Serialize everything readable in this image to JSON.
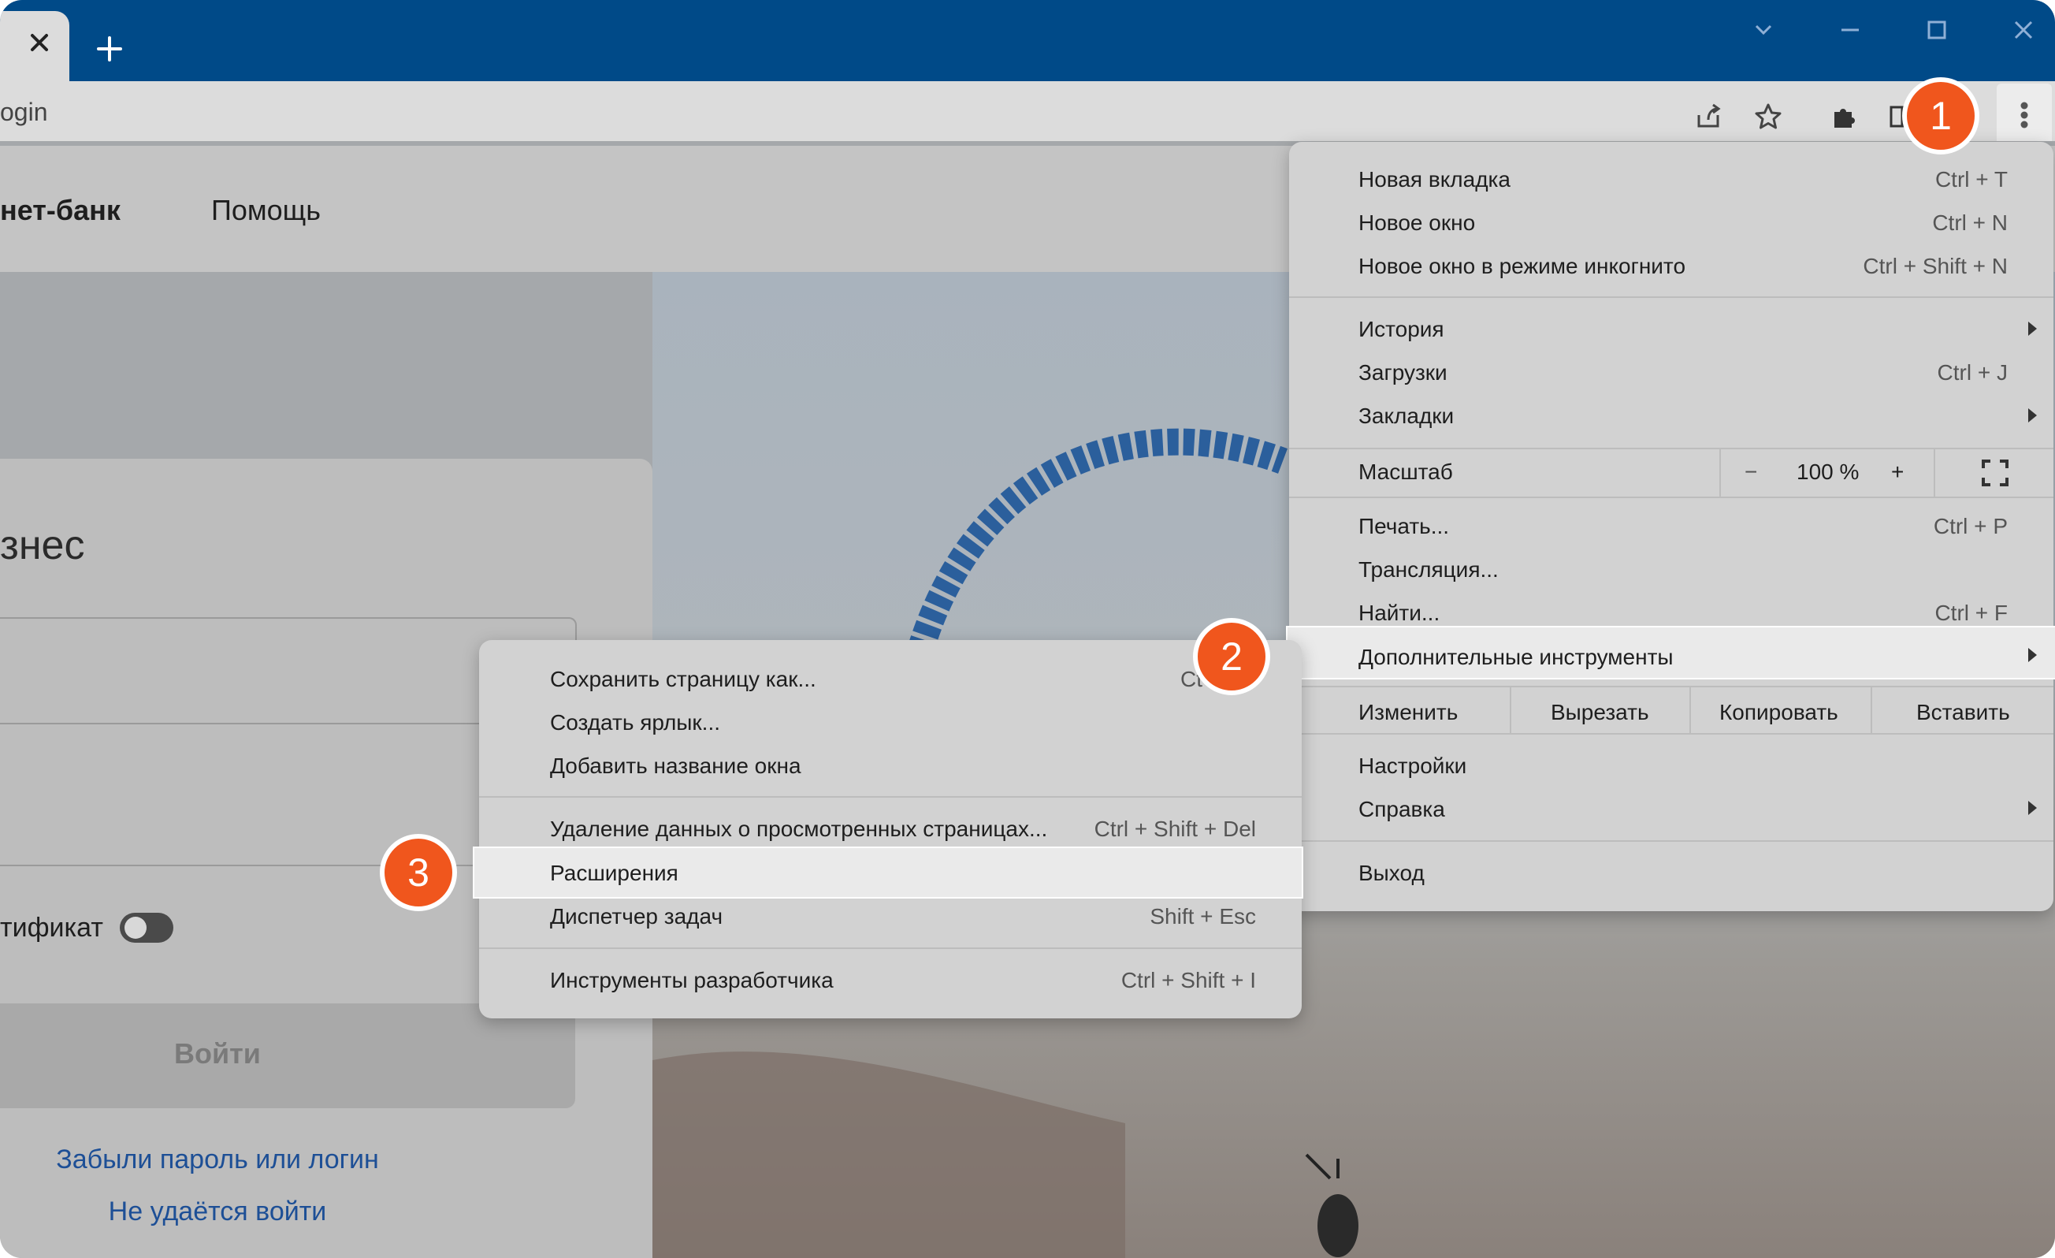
{
  "browser": {
    "new_tab_symbol": "+",
    "address": "ogin",
    "window_controls": [
      "chevron-down-icon",
      "minimize-icon",
      "maximize-icon",
      "close-icon"
    ],
    "toolbar_icons": [
      "share-icon",
      "star-icon",
      "puzzle-icon",
      "sidepanel-icon"
    ]
  },
  "page": {
    "nav": {
      "bank": "нет-банк",
      "help": "Помощь"
    },
    "card_title": "знес",
    "cert_label": "тификат",
    "login_button": "Войти",
    "forgot_link": "Забыли пароль или логин",
    "cant_login_link": "Не удаётся войти"
  },
  "main_menu": {
    "new_tab": {
      "label": "Новая вкладка",
      "shortcut": "Ctrl + T"
    },
    "new_window": {
      "label": "Новое окно",
      "shortcut": "Ctrl + N"
    },
    "incognito": {
      "label": "Новое окно в режиме инкогнито",
      "shortcut": "Ctrl + Shift + N"
    },
    "history": {
      "label": "История"
    },
    "downloads": {
      "label": "Загрузки",
      "shortcut": "Ctrl + J"
    },
    "bookmarks": {
      "label": "Закладки"
    },
    "zoom": {
      "label": "Масштаб",
      "minus": "−",
      "value": "100 %",
      "plus": "+"
    },
    "print": {
      "label": "Печать...",
      "shortcut": "Ctrl + P"
    },
    "cast": {
      "label": "Трансляция..."
    },
    "find": {
      "label": "Найти...",
      "shortcut": "Ctrl + F"
    },
    "more_tools": {
      "label": "Дополнительные инструменты"
    },
    "edit": {
      "label": "Изменить",
      "cut": "Вырезать",
      "copy": "Копировать",
      "paste": "Вставить"
    },
    "settings": {
      "label": "Настройки"
    },
    "help": {
      "label": "Справка"
    },
    "exit": {
      "label": "Выход"
    }
  },
  "submenu": {
    "save_page": {
      "label": "Сохранить страницу как...",
      "shortcut": "Ct"
    },
    "create_shortcut": {
      "label": "Создать ярлык..."
    },
    "name_window": {
      "label": "Добавить название окна"
    },
    "clear_data": {
      "label": "Удаление данных о просмотренных страницах...",
      "shortcut": "Ctrl + Shift + Del"
    },
    "extensions": {
      "label": "Расширения"
    },
    "task_manager": {
      "label": "Диспетчер задач",
      "shortcut": "Shift + Esc"
    },
    "dev_tools": {
      "label": "Инструменты разработчика",
      "shortcut": "Ctrl + Shift + I"
    }
  },
  "badges": [
    "1",
    "2",
    "3"
  ],
  "colors": {
    "titlebar": "#004a88",
    "badge": "#f0561d",
    "link": "#1d4f96"
  }
}
